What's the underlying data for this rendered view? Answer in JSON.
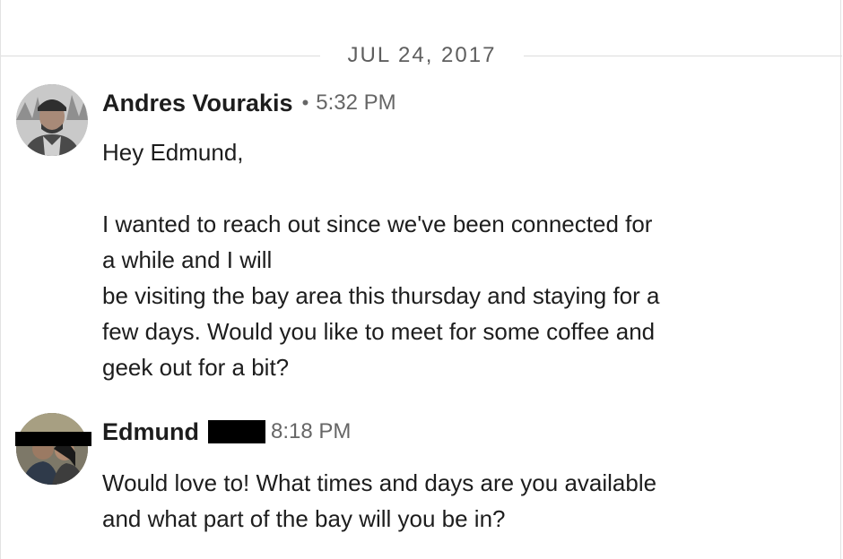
{
  "conversation": {
    "date_label": "JUL 24, 2017",
    "messages": [
      {
        "sender": "Andres Vourakis",
        "separator": "•",
        "time": "5:32 PM",
        "lines": [
          "Hey Edmund,",
          "",
          "I wanted to reach out since we've been connected for",
          "a while and I will",
          "be visiting the bay area this thursday and staying for a",
          "few days. Would you like to meet for some coffee and",
          "geek out for a bit?"
        ]
      },
      {
        "sender": "Edmund",
        "time": "8:18 PM",
        "lines": [
          "Would love to! What times and days are you available",
          "and what part of the bay will you be in?"
        ]
      }
    ]
  }
}
